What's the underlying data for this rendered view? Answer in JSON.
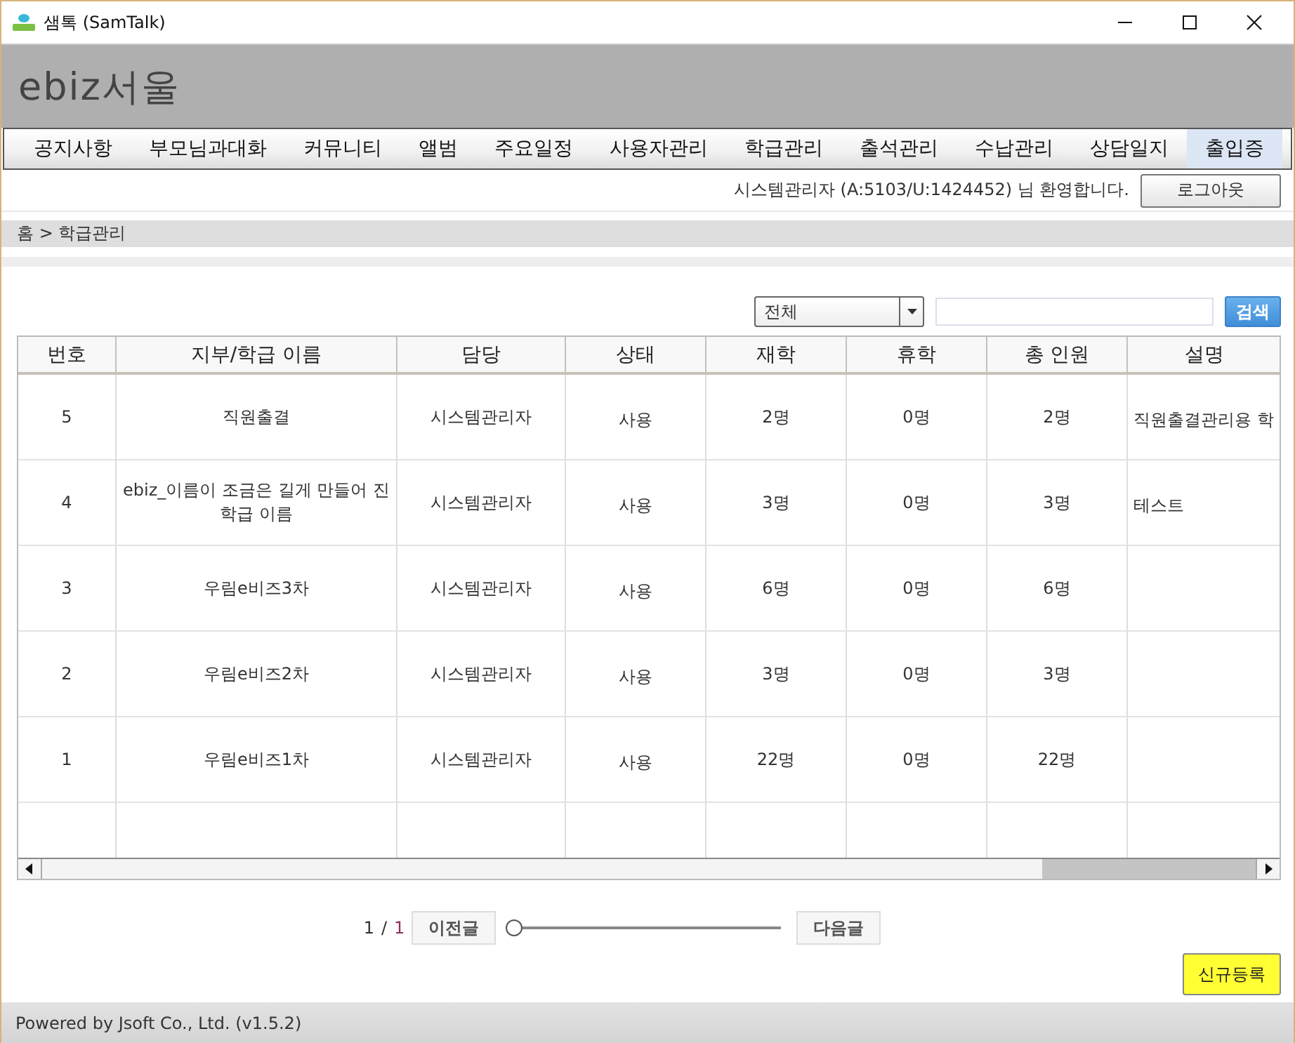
{
  "window": {
    "title": "샘톡 (SamTalk)"
  },
  "header": {
    "title": "ebiz서울"
  },
  "nav": [
    {
      "label": "공지사항",
      "selected": false
    },
    {
      "label": "부모님과대화",
      "selected": false
    },
    {
      "label": "커뮤니티",
      "selected": false
    },
    {
      "label": "앨범",
      "selected": false
    },
    {
      "label": "주요일정",
      "selected": false
    },
    {
      "label": "사용자관리",
      "selected": false
    },
    {
      "label": "학급관리",
      "selected": false
    },
    {
      "label": "출석관리",
      "selected": false
    },
    {
      "label": "수납관리",
      "selected": false
    },
    {
      "label": "상담일지",
      "selected": false
    },
    {
      "label": "출입증",
      "selected": true
    }
  ],
  "welcome": "시스템관리자 (A:5103/U:1424452) 님 환영합니다.",
  "logout_button": "로그아웃",
  "breadcrumb": "홈 > 학급관리",
  "filter": {
    "value": "전체"
  },
  "search_button": "검색",
  "table": {
    "columns": [
      "번호",
      "지부/학급 이름",
      "담당",
      "상태",
      "재학",
      "휴학",
      "총 인원",
      "설명"
    ],
    "rows": [
      [
        "5",
        "직원출결",
        "시스템관리자",
        "사용",
        "2명",
        "0명",
        "2명",
        "직원출결관리용 학"
      ],
      [
        "4",
        "ebiz_이름이 조금은 길게 만들어 진 학급 이름",
        "시스템관리자",
        "사용",
        "3명",
        "0명",
        "3명",
        "테스트"
      ],
      [
        "3",
        "우림e비즈3차",
        "시스템관리자",
        "사용",
        "6명",
        "0명",
        "6명",
        ""
      ],
      [
        "2",
        "우림e비즈2차",
        "시스템관리자",
        "사용",
        "3명",
        "0명",
        "3명",
        ""
      ],
      [
        "1",
        "우림e비즈1차",
        "시스템관리자",
        "사용",
        "22명",
        "0명",
        "22명",
        ""
      ]
    ]
  },
  "pagination": {
    "current": "1",
    "separator": "/",
    "total": "1",
    "prev": "이전글",
    "next": "다음글",
    "level": 0
  },
  "new_button": "신규등록",
  "footer": "Powered by Jsoft Co., Ltd. (v1.5.2)"
}
